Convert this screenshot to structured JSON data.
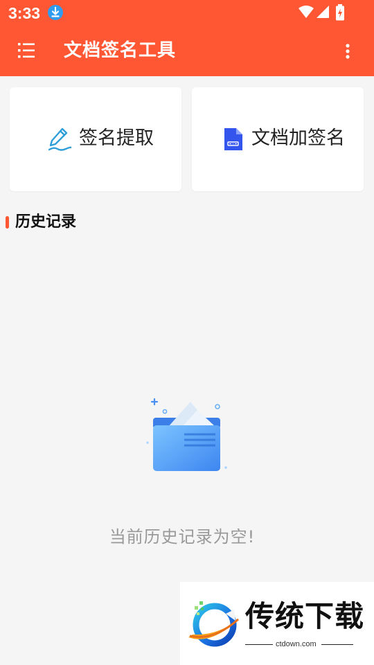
{
  "status_bar": {
    "time": "3:33",
    "icons": [
      "download-icon",
      "wifi-icon",
      "signal-icon",
      "battery-charging-icon"
    ]
  },
  "app_bar": {
    "title": "文档签名工具",
    "menu_icon": "list-menu-icon",
    "overflow_icon": "more-vertical-icon"
  },
  "cards": [
    {
      "label": "签名提取",
      "icon": "signature-pen-icon",
      "color": "#2e9fd8"
    },
    {
      "label": "文档加签名",
      "icon": "document-icon",
      "color": "#3355ee"
    }
  ],
  "history": {
    "title": "历史记录",
    "empty_text": "当前历史记录为空!",
    "empty_icon": "empty-folder-icon"
  },
  "watermark": {
    "brand": "传统下载",
    "url": "ctdown.com"
  },
  "colors": {
    "primary": "#ff5733",
    "background": "#f5f5f5"
  }
}
